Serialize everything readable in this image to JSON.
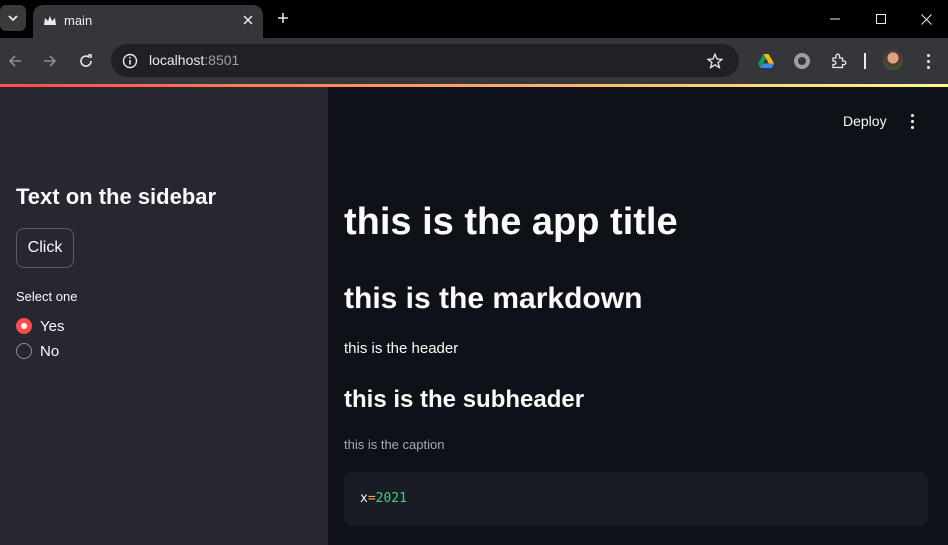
{
  "browser": {
    "tab_title": "main",
    "url_host": "localhost",
    "url_port": ":8501"
  },
  "sidebar": {
    "title": "Text on the sidebar",
    "button_label": "Click",
    "radio": {
      "label": "Select one",
      "options": [
        "Yes",
        "No"
      ],
      "selected": "Yes"
    }
  },
  "main": {
    "deploy_label": "Deploy",
    "title": "this is the app title",
    "markdown": "this is the markdown",
    "header": "this is the header",
    "subheader": "this is the subheader",
    "caption": "this is the caption",
    "code": {
      "var": "x",
      "op": "=",
      "value": "2021"
    }
  },
  "colors": {
    "accent": "#ff4b4b",
    "sidebar_bg": "#262730",
    "main_bg": "#0e1117"
  }
}
